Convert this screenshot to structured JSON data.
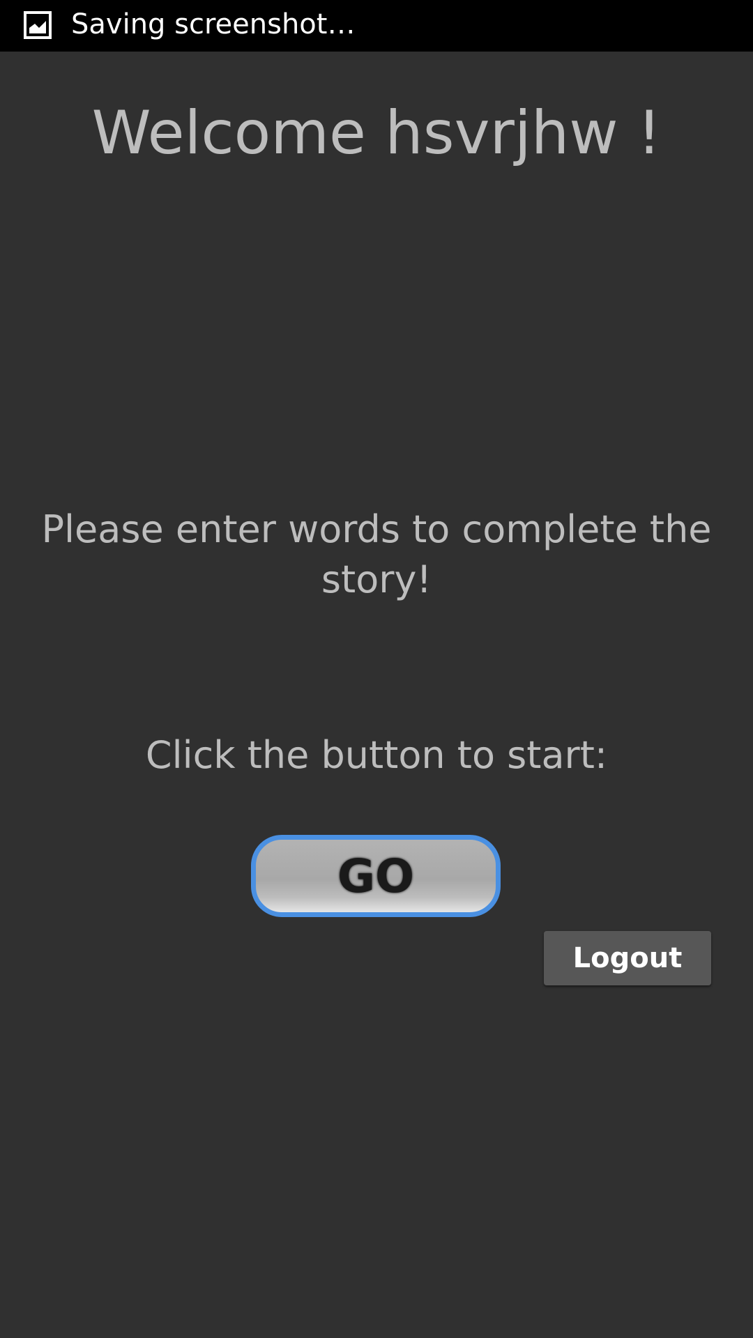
{
  "status_bar": {
    "icon": "image-icon",
    "text": "Saving screenshot…"
  },
  "main": {
    "welcome": "Welcome hsvrjhw !",
    "instructions": "Please enter words to complete the story!",
    "start_hint": "Click the button to start:",
    "go_label": "GO",
    "logout_label": "Logout"
  },
  "colors": {
    "background": "#303030",
    "text": "#bdbdbd",
    "go_border": "#4a90e2",
    "logout_bg": "#575757"
  }
}
